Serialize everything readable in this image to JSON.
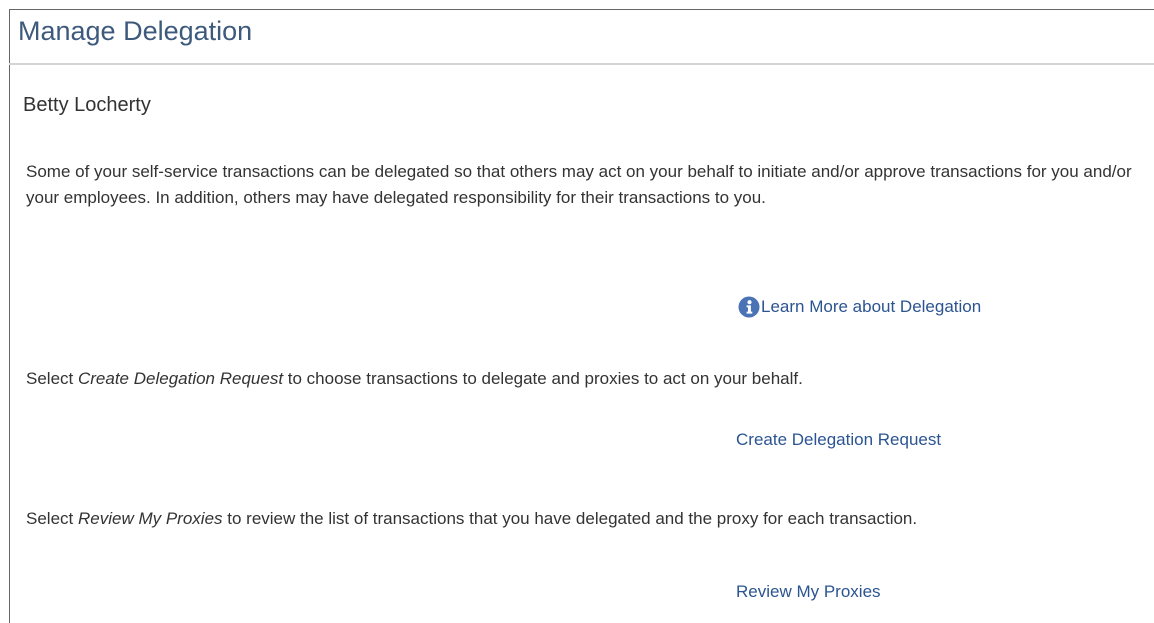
{
  "page": {
    "title": "Manage Delegation",
    "user_name": "Betty Locherty",
    "intro_text": "Some of your self-service transactions can be delegated so that others may act on your behalf to initiate and/or approve transactions for you and/or your employees. In addition, others may have delegated responsibility for their transactions to you.",
    "learn_more": {
      "icon": "info-icon",
      "label": "Learn More about Delegation"
    },
    "create": {
      "prefix": "Select ",
      "emphasis": "Create Delegation Request",
      "suffix": " to choose transactions to delegate and proxies to act on your behalf.",
      "link_label": "Create Delegation Request"
    },
    "review": {
      "prefix": "Select ",
      "emphasis": "Review My Proxies",
      "suffix": " to review the list of transactions that you have delegated and the proxy for each transaction.",
      "link_label": "Review My Proxies"
    }
  },
  "colors": {
    "title": "#3d5a7d",
    "link": "#2b5491",
    "text": "#333333",
    "rule": "#d4d4d4",
    "info_icon": "#4a73b6"
  }
}
